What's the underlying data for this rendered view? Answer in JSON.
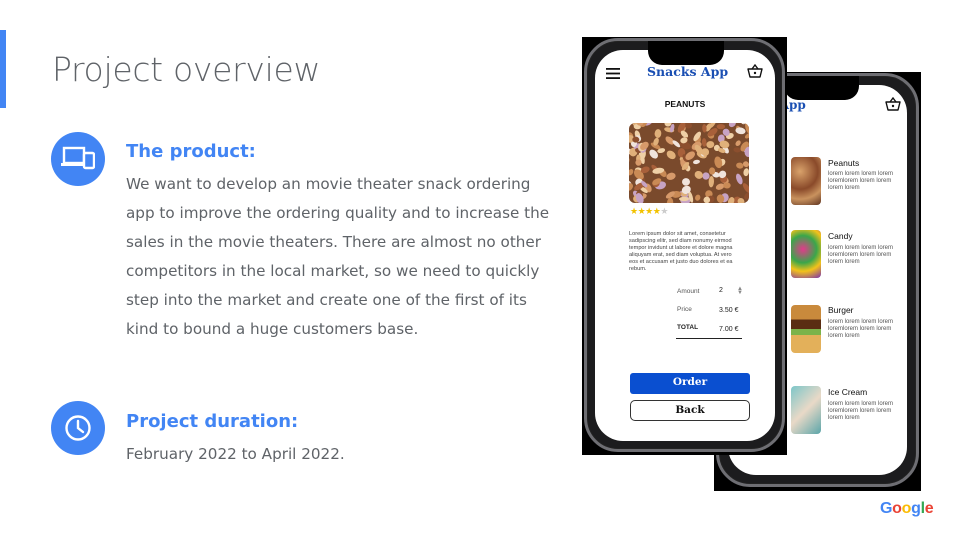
{
  "slide": {
    "title": "Project overview",
    "product": {
      "heading": "The product:",
      "lines": [
        "We want to develop an movie theater snack ordering",
        "app to improve the ordering quality and to increase the",
        "sales in the movie theaters. There are almost no other",
        "competitors in the local market, so we need to quickly",
        "step into the market and create one of the first of its",
        "kind to bound a huge customers base."
      ],
      "icon": "devices-icon"
    },
    "duration": {
      "heading": "Project duration:",
      "text": "February 2022 to April 2022.",
      "icon": "clock-icon"
    },
    "accent_color": "#4285f4"
  },
  "list_screen": {
    "app_title": "Snacks App",
    "items": [
      {
        "name": "Peanuts",
        "desc": "lorem lorem lorem lorem loremlorem lorem lorem lorem lorem"
      },
      {
        "name": "Candy",
        "desc": "lorem lorem lorem lorem loremlorem lorem lorem lorem lorem"
      },
      {
        "name": "Burger",
        "desc": "lorem lorem lorem lorem loremlorem lorem lorem lorem lorem"
      },
      {
        "name": "Ice Cream",
        "desc": "lorem lorem lorem lorem loremlorem lorem lorem lorem lorem"
      }
    ]
  },
  "detail_screen": {
    "app_title": "Snacks App",
    "product_title": "PEANUTS",
    "rating": 4,
    "rating_max": 5,
    "description_lines": [
      "Lorem ipsum dolor sit amet, consetetur",
      "sadipscing elitr, sed diam nonumy eirmod",
      "tempor invidunt ut labore et dolore magna",
      "aliquyam erat, sed diam voluptua. At vero",
      "eos et accusam et justo duo dolores et ea",
      "rebum."
    ],
    "amount_label": "Amount",
    "amount_value": "2",
    "price_label": "Price",
    "price_value": "3.50 €",
    "total_label": "TOTAL",
    "total_value": "7.00 €",
    "order_label": "Order",
    "back_label": "Back"
  },
  "branding": {
    "logo_letters": [
      "G",
      "o",
      "o",
      "g",
      "l",
      "e"
    ],
    "logo_colors": [
      "#4285f4",
      "#ea4335",
      "#fbbc05",
      "#4285f4",
      "#34a853",
      "#ea4335"
    ]
  }
}
